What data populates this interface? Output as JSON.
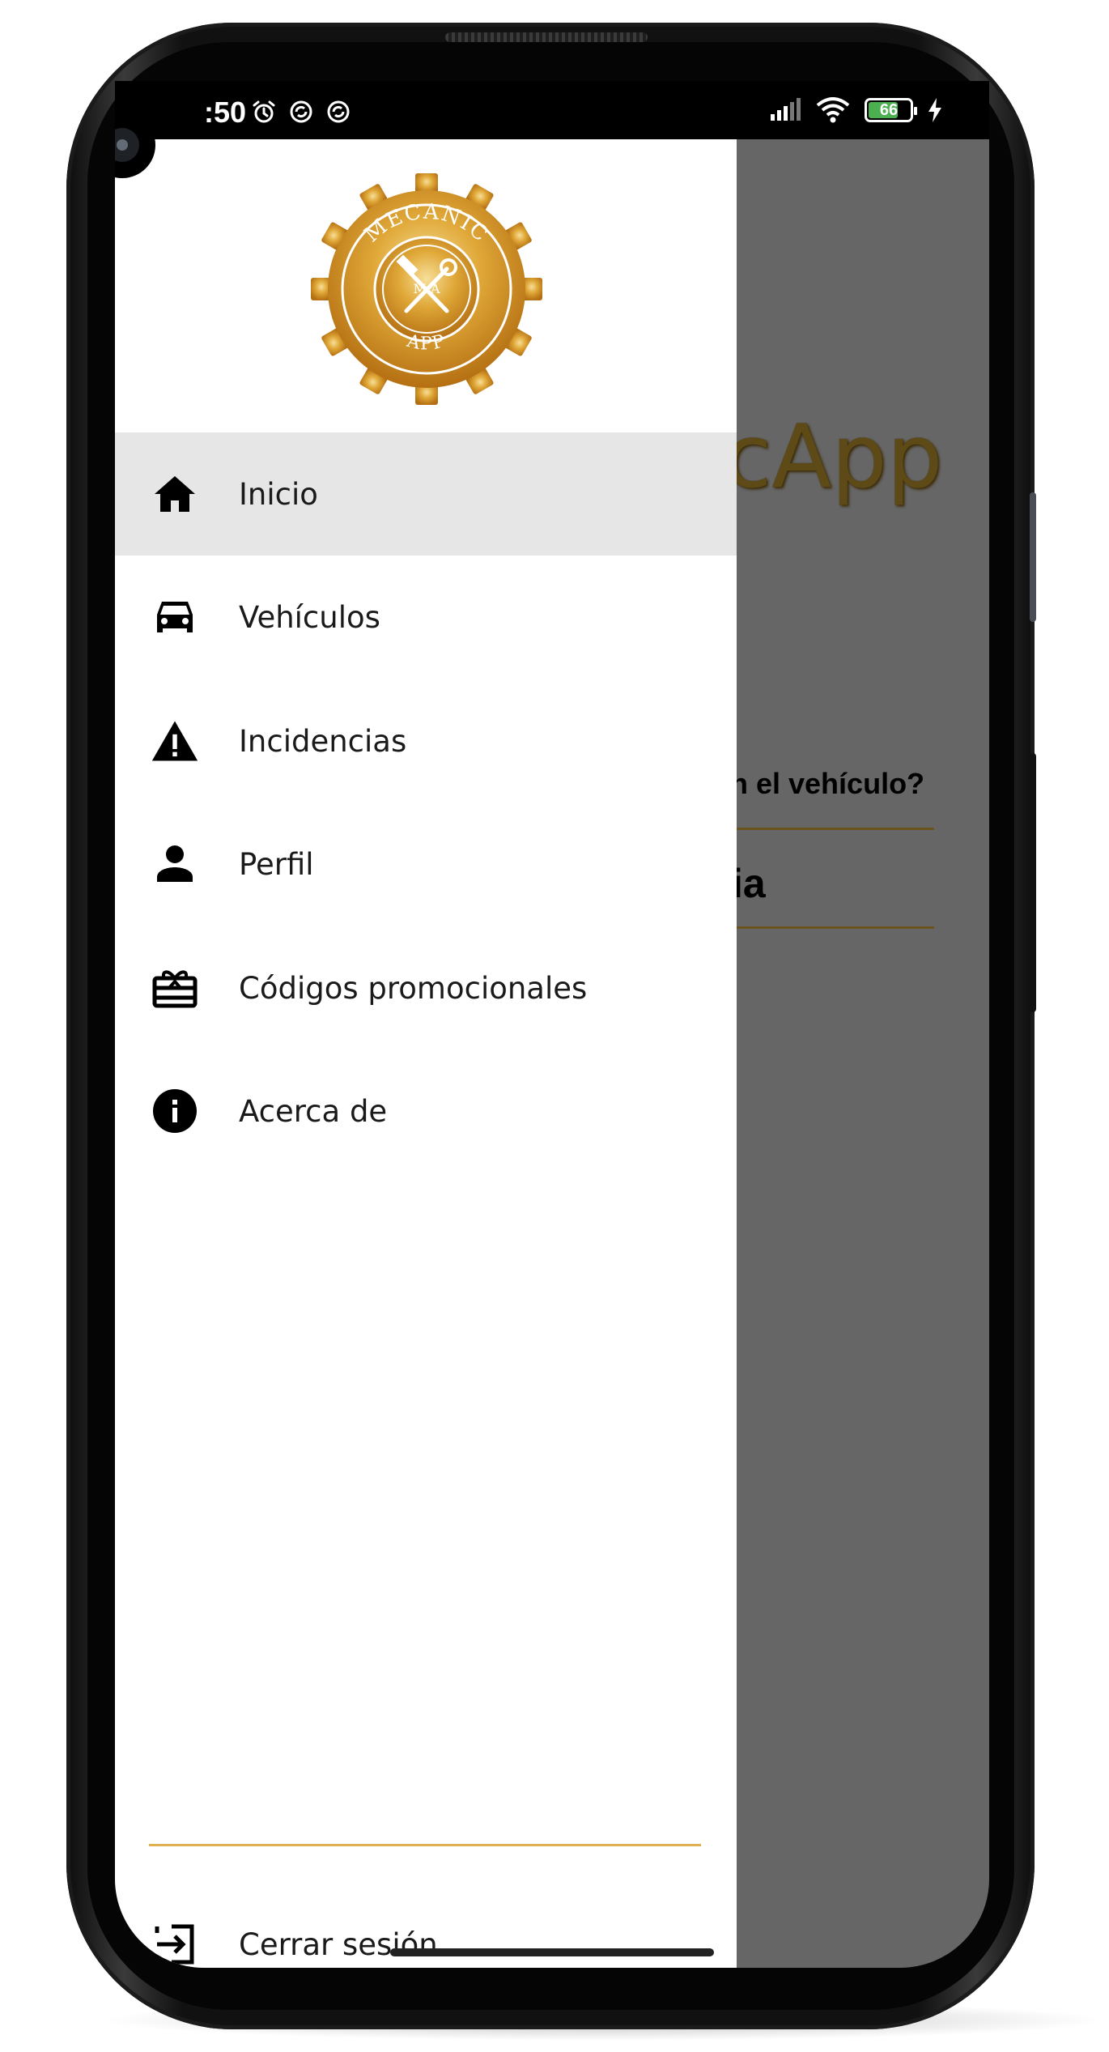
{
  "status_bar": {
    "time": ":50",
    "battery": "66",
    "icons_left": [
      "alarm-icon",
      "sync-icon",
      "sync-icon"
    ],
    "icons_right": [
      "signal-icon",
      "wifi-icon",
      "battery-icon",
      "charging-icon"
    ]
  },
  "background_screen": {
    "title_partial": "cApp",
    "question_partial": "n el vehículo?",
    "input_partial": "ia"
  },
  "drawer": {
    "logo": {
      "top_text": "MECANIC",
      "bottom_text": "APP",
      "monogram": "M  A"
    },
    "items": [
      {
        "label": "Inicio",
        "icon": "home-icon",
        "active": true
      },
      {
        "label": "Vehículos",
        "icon": "car-icon",
        "active": false
      },
      {
        "label": "Incidencias",
        "icon": "warning-icon",
        "active": false
      },
      {
        "label": "Perfil",
        "icon": "person-icon",
        "active": false
      },
      {
        "label": "Códigos promocionales",
        "icon": "gift-card-icon",
        "active": false
      },
      {
        "label": "Acerca de",
        "icon": "info-icon",
        "active": false
      }
    ],
    "logout": {
      "label": "Cerrar sesión",
      "icon": "logout-icon"
    }
  },
  "colors": {
    "accent_gold": "#E0B050",
    "scrim": "#666666",
    "active_item_bg": "#E6E6E6"
  }
}
